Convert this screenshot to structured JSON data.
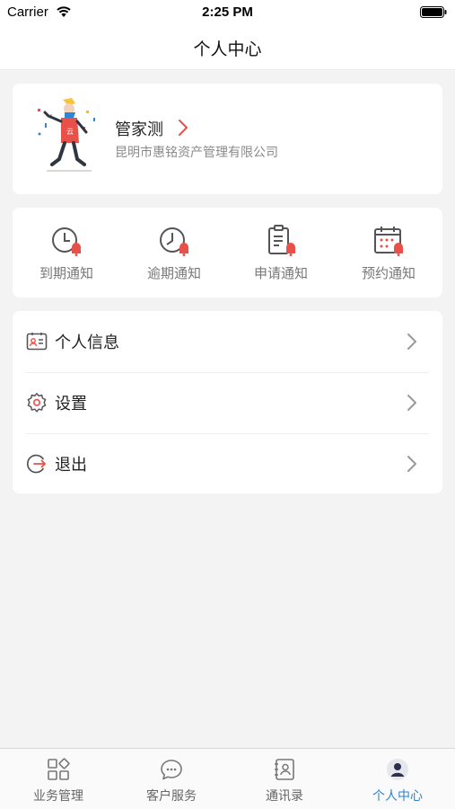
{
  "status_bar": {
    "carrier": "Carrier",
    "time": "2:25 PM"
  },
  "nav": {
    "title": "个人中心"
  },
  "profile": {
    "name": "管家测",
    "company": "昆明市惠铭资产管理有限公司"
  },
  "notifications": [
    {
      "label": "到期通知",
      "icon": "clock-bell-icon"
    },
    {
      "label": "逾期通知",
      "icon": "clock-bell-icon"
    },
    {
      "label": "申请通知",
      "icon": "document-bell-icon"
    },
    {
      "label": "预约通知",
      "icon": "calendar-bell-icon"
    }
  ],
  "menu": [
    {
      "label": "个人信息",
      "icon": "id-card-icon"
    },
    {
      "label": "设置",
      "icon": "gear-icon"
    },
    {
      "label": "退出",
      "icon": "logout-icon"
    }
  ],
  "tabs": [
    {
      "label": "业务管理",
      "icon": "grid-icon",
      "active": false
    },
    {
      "label": "客户服务",
      "icon": "chat-icon",
      "active": false
    },
    {
      "label": "通讯录",
      "icon": "contacts-icon",
      "active": false
    },
    {
      "label": "个人中心",
      "icon": "person-icon",
      "active": true
    }
  ],
  "colors": {
    "accent_red": "#e8504a",
    "active_tab": "#2f86d6",
    "icon_gray": "#555555"
  }
}
